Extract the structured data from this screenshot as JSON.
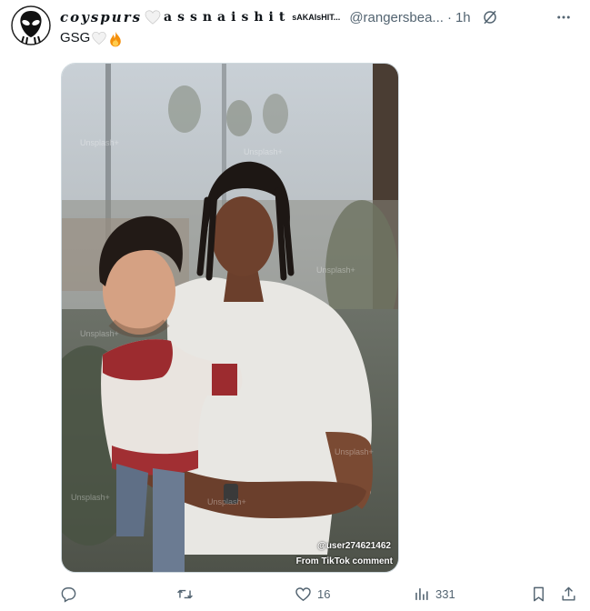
{
  "tweet": {
    "author_name_part1": "coyspurs",
    "author_name_part2": "assnaishit",
    "author_name_suffix": "sAKAIsHIT...",
    "handle": "@rangersbea...",
    "separator": "·",
    "time": "1h",
    "text": "GSG",
    "icons": [
      "alien-avatar-icon",
      "white-heart-icon",
      "grok-icon",
      "more-icon",
      "fire-icon"
    ]
  },
  "media": {
    "watermark_line1": "@user274621462",
    "watermark_line2": "From TikTok comment",
    "faint_watermark": "Unsplash+"
  },
  "actions": {
    "reply_count": "",
    "retweet_count": "",
    "like_count": "16",
    "view_count": "331",
    "icons": [
      "reply-icon",
      "retweet-icon",
      "like-icon",
      "views-icon",
      "bookmark-icon",
      "share-icon"
    ]
  },
  "colors": {
    "text": "#0f1419",
    "secondary": "#536471",
    "border": "#cfd9de"
  }
}
